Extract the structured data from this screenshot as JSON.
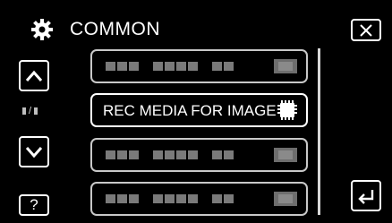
{
  "header": {
    "title": "COMMON",
    "icon": "gear-icon"
  },
  "buttons": {
    "close_icon": "close-icon",
    "up_icon": "arrow-up-icon",
    "down_icon": "arrow-down-icon",
    "help_label": "?",
    "back_icon": "return-icon"
  },
  "page_indicator": {
    "separator": "/"
  },
  "menu": {
    "items": [
      {
        "label": "",
        "state": "disabled"
      },
      {
        "label": "REC MEDIA FOR IMAGE",
        "state": "enabled",
        "icon": "media-card-icon"
      },
      {
        "label": "",
        "state": "disabled"
      },
      {
        "label": "",
        "state": "disabled"
      }
    ]
  },
  "scrollbar": {
    "position_fraction": 0.0,
    "visible_fraction": 0.25
  },
  "colors": {
    "background": "#000000",
    "text": "#ffffff",
    "disabled_text": "#7a7a7a",
    "border": "#c8c8c8"
  }
}
